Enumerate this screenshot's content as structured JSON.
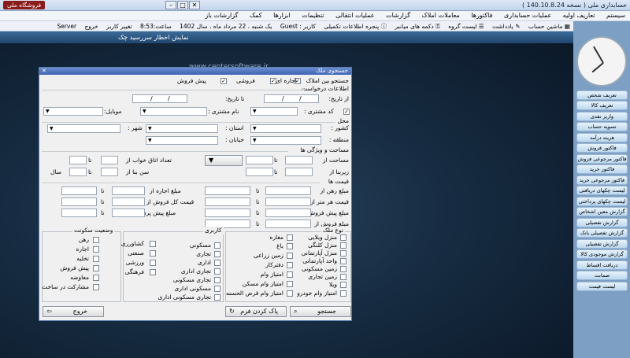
{
  "window": {
    "title": "حسابداری ملی ( نسخه 140.10.8.24 )",
    "title_badge": "فروشگاه ملی"
  },
  "menu": [
    "سیستم",
    "تعاریف اولیه",
    "عملیات حسابداری",
    "فاکتورها",
    "معاملات املاک",
    "گزارشات",
    "عملیات انتقالی",
    "تنظیمات",
    "ابزارها",
    "کمک",
    "گزارشات باز"
  ],
  "statusbar": {
    "calculator": "ماشین حساب",
    "notes": "یادداشت",
    "call_list": "لیست گروه",
    "car_keys": "دکمه های میانبر",
    "extra_info": "پنجره اطلاعات تکمیلی",
    "user": "کاربر : Guest",
    "date": "یک شنبه ، 22 مرداد ماه ، سال 1402",
    "time": "ساعت:8:53",
    "change_user": "تغییر کاربر",
    "exit": "خروج",
    "server": "Server"
  },
  "report_bar": "نمایش اخطار سررسید چک",
  "watermark": "www.centersoftware.ir",
  "sidebar": [
    "تعریف شخص",
    "تعریف کالا",
    "واریز نقدی",
    "تسویه حساب",
    "هزینه درآمد",
    "فاکتور فروش",
    "فاکتور مرجوعی فروش",
    "فاکتور خرید",
    "فاکتور مرجوعی خرید",
    "لیست چکهای دریافتی",
    "لیست چکهای پرداختی",
    "گزارش معین اشخاص",
    "گزارش تفصیلی اشخاص",
    "گزارش تفصیلی بانک",
    "گزارش تفصیلی صندوق",
    "گزارش موجودی کالا",
    "دریافت اقساط",
    "ضمانت",
    "لیست قیمت"
  ],
  "dialog": {
    "title": "جستجوی ملک",
    "search_in": "جستجو بین املاک",
    "types": [
      "پیش فروش",
      "فروشی",
      "اجاره ای"
    ],
    "request_info": "اطلاعات درخواست",
    "from_date": "از تاریخ:",
    "to_date": "تا تاریخ:",
    "customer_code": "کد مشتری :",
    "customer_name": "نام مشتری :",
    "mobile": "موبایل:",
    "location": "محل",
    "country": "کشور :",
    "province": "استان :",
    "city": "شهر :",
    "region": "منطقه :",
    "street": "خیابان :",
    "area_features": "مساحت و ویژگی ها",
    "area_from": "مساحت از",
    "to": "تا",
    "bedrooms": "تعداد اتاق خواب از",
    "floor_from": "زیربنا از",
    "age_from": "سن بنا از",
    "years": "سال",
    "price": "قیمت ها",
    "deposit": "مبلغ رهن از",
    "rent": "مبلغ اجاره از",
    "meter_price": "قیمت هر متر از",
    "total_price": "قیمت کل فروش از",
    "presale": "مبلغ پیش فروش از",
    "prepay": "مبلغ پیش پرداخت از",
    "sale": "مبلغ فروش از",
    "status_title": "وضعیت سکونت",
    "status": [
      "رهن",
      "اجاره",
      "تخلیه",
      "پیش فروش",
      "معاوضه",
      "مشارکت در ساخت"
    ],
    "usage_title": "کاربری",
    "usage_right": [
      "مسکونی",
      "تجاری",
      "اداری",
      "تجاری اداری",
      "تجاری مسکونی",
      "مسکونی اداری",
      "تجاری مسکونی اداری"
    ],
    "usage_left": [
      "کشاورزی",
      "صنعتی",
      "ورزشی",
      "فرهنگی"
    ],
    "kind_title": "نوع ملک",
    "kind_right": [
      "منزل ویلایی",
      "منزل کلنگی",
      "منزل آپارتمانی",
      "واحد آپارتمانی",
      "زمین مسکونی",
      "زمین تجاری",
      "ویلا",
      "امتیاز وام خودرو"
    ],
    "kind_left": [
      "مغازه",
      "باغ",
      "زمین زراعی",
      "دفترکار",
      "امتیاز وام",
      "امتیاز وام مسکن",
      "امتیاز وام قرض الحسنه"
    ],
    "search_btn": "جستجو",
    "clear_btn": "پاک کردن فرم",
    "exit_btn": "خروج"
  }
}
